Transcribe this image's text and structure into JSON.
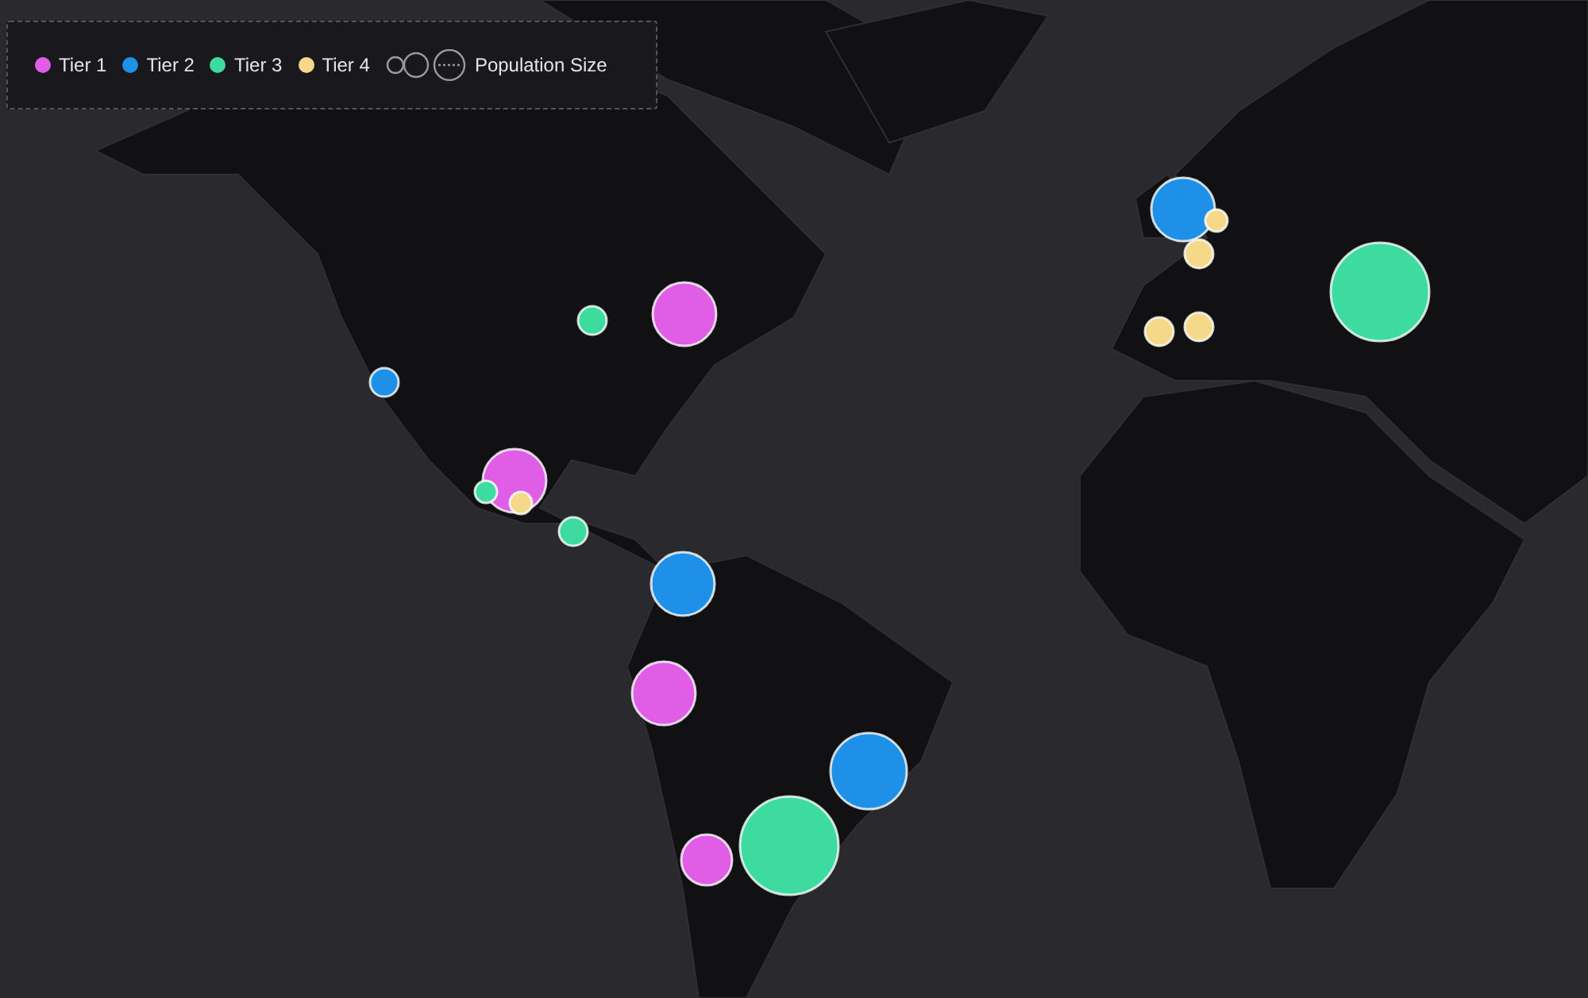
{
  "legend": {
    "tiers": [
      {
        "label": "Tier 1",
        "color": "#e05ee6"
      },
      {
        "label": "Tier 2",
        "color": "#1e90e8"
      },
      {
        "label": "Tier 3",
        "color": "#3ddba0"
      },
      {
        "label": "Tier 4",
        "color": "#f5d88a"
      }
    ],
    "size_label": "Population Size"
  },
  "bubbles": [
    {
      "color": "#e05ee6",
      "kind": "large"
    },
    {
      "color": "#3ddba0",
      "kind": "small"
    },
    {
      "color": "#1e90e8",
      "kind": "small"
    },
    {
      "color": "#e05ee6",
      "kind": "large"
    },
    {
      "color": "#3ddba0",
      "kind": "tiny"
    },
    {
      "color": "#f5d88a",
      "kind": "tiny"
    },
    {
      "color": "#3ddba0",
      "kind": "small"
    },
    {
      "color": "#1e90e8",
      "kind": "large"
    },
    {
      "color": "#e05ee6",
      "kind": "large"
    },
    {
      "color": "#1e90e8",
      "kind": "xlarge"
    },
    {
      "color": "#3ddba0",
      "kind": "huge"
    },
    {
      "color": "#e05ee6",
      "kind": "medium"
    },
    {
      "color": "#1e90e8",
      "kind": "large"
    },
    {
      "color": "#f5d88a",
      "kind": "tiny"
    },
    {
      "color": "#f5d88a",
      "kind": "small"
    },
    {
      "color": "#3ddba0",
      "kind": "huge"
    },
    {
      "color": "#f5d88a",
      "kind": "small"
    },
    {
      "color": "#f5d88a",
      "kind": "small"
    }
  ]
}
